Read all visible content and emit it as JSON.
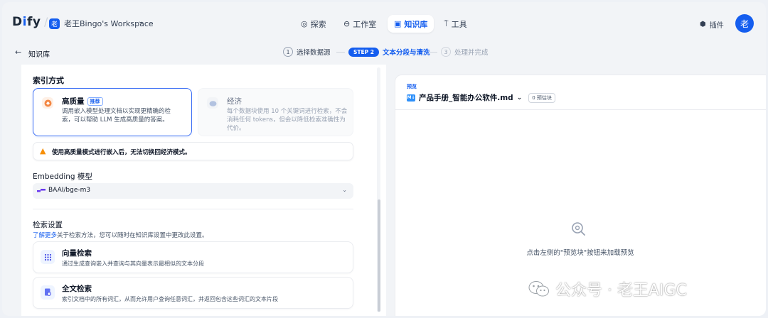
{
  "app": {
    "logo": "Dify",
    "workspace_badge": "老",
    "workspace_name": "老王Bingo's Workspace"
  },
  "nav": [
    {
      "label": "探索",
      "icon": "compass-icon"
    },
    {
      "label": "工作室",
      "icon": "robot-icon"
    },
    {
      "label": "知识库",
      "icon": "book-icon",
      "active": true
    },
    {
      "label": "工具",
      "icon": "tool-icon"
    }
  ],
  "header_right": {
    "plugin_label": "插件",
    "avatar": "老"
  },
  "subheader": {
    "back_label": "知识库",
    "steps": [
      {
        "num": "1",
        "label": "选择数据源"
      },
      {
        "num": "STEP 2",
        "label": "文本分段与清洗"
      },
      {
        "num": "3",
        "label": "处理并完成"
      }
    ]
  },
  "index": {
    "title": "索引方式",
    "high": {
      "title": "高质量",
      "tag": "推荐",
      "desc": [
        "调用嵌入模型处理文档以实现更精确的检",
        "索，可以帮助 LLM 生成高质量的答案。"
      ]
    },
    "eco": {
      "title": "经济",
      "desc": [
        "每个数据块使用 10 个关键词进行检索，不会",
        "消耗任何 tokens，但会以降低检索准确性为",
        "代价。"
      ]
    },
    "warning": "使用高质量模式进行嵌入后，无法切换回经济模式。"
  },
  "embedding": {
    "title": "Embedding 模型",
    "value": "BAAI/bge-m3"
  },
  "retrieval": {
    "title": "检索设置",
    "learn_more": "了解更多",
    "learn_rest": "关于检索方法，您可以随时在知识库设置中更改此设置。",
    "vector": {
      "title": "向量检索",
      "desc": "通过生成查询嵌入并查询与其向量表示最相似的文本分段"
    },
    "fulltext": {
      "title": "全文检索",
      "desc": "索引文档中的所有词汇，从而允许用户查询任意词汇，并返回包含这些词汇的文本片段"
    }
  },
  "preview": {
    "label": "预览",
    "md_badge": "M↓",
    "file": "产品手册_智能办公软件.md",
    "estimate": "0 预估块",
    "hint": "点击左侧的\"预览块\"按钮来加载预览"
  },
  "watermark": "公众号 · 老王AIGC",
  "colors": {
    "accent": "#155eef",
    "warning": "#f79009",
    "background": "#f2f4f7"
  }
}
